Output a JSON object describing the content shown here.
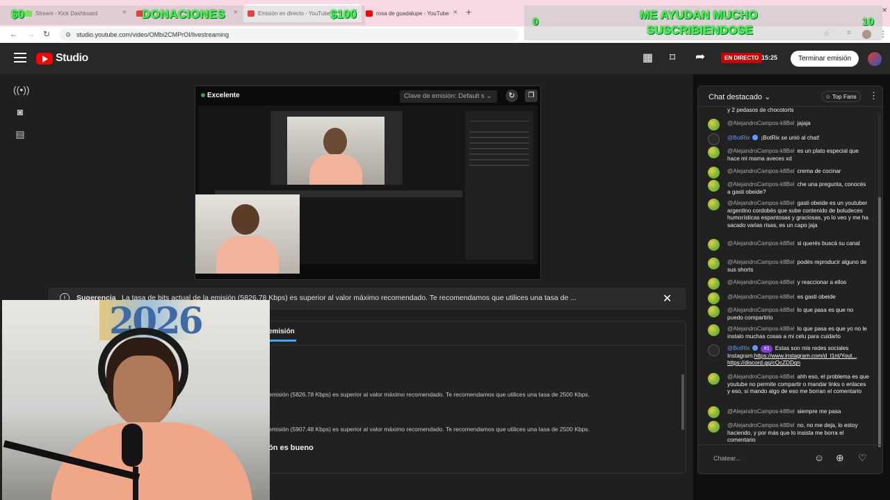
{
  "browser": {
    "tabs": [
      {
        "label": "Stream - Kick Dashboard",
        "favicon_color": "#53fc18"
      },
      {
        "label": "YouTube",
        "favicon_color": "#ff0000"
      },
      {
        "label": "Emisión en directo - YouTube",
        "favicon_color": "#ff0000"
      },
      {
        "label": "rosa de guadalupe - YouTube",
        "favicon_color": "#ff0000"
      }
    ],
    "url": "studio.youtube.com/video/OMbi2CMPrOI/livestreaming"
  },
  "overlay": {
    "left": {
      "amount_start": "$0",
      "title": "DONACIONES",
      "amount_goal": "$100"
    },
    "right": {
      "line1": "ME AYUDAN MUCHO",
      "line2": "SUSCRIBIENDOSE",
      "count_start": "0",
      "count_goal": "10"
    }
  },
  "studio": {
    "brand": "Studio",
    "live_label": "EN DIRECTO",
    "live_time": "15:25",
    "end_button": "Terminar emisión"
  },
  "preview": {
    "quality": "Excelente",
    "stream_key": "Clave de emisión: Default s"
  },
  "suggestion": {
    "title": "Sugerencia",
    "text": "La tasa de bits actual de la emisión (5826.78 Kbps) es superior al valor máximo recomendado. Te recomendamos que utilices una tasa de ..."
  },
  "panel": {
    "tab": "emisión",
    "rows": [
      "emisión (5826.78 Kbps) es superior al valor máximo recomendado. Te recomendamos que utilices una tasa de 2500 Kbps.",
      "emisión (5907.48 Kbps) es superior al valor máximo recomendado. Te recomendamos que utilices una tasa de 2500 Kbps.",
      "ón es bueno"
    ]
  },
  "webcam": {
    "sign": "2026"
  },
  "chat": {
    "title": "Chat destacado",
    "top_fans": "Top Fans",
    "input_placeholder": "Chatear...",
    "top_fragment": "y 2 pedasos de chocotorts",
    "messages": [
      {
        "author": "@AlejandroCampos-k8Bel",
        "text": "jajaja"
      },
      {
        "author": "@BotRix",
        "text": "¡BotRix se unió al chat!"
      },
      {
        "author": "@AlejandroCampos-k8Bel",
        "text": "es un plato especial que hace mi mama aveces xd"
      },
      {
        "author": "@AlejandroCampos-k8Bel",
        "text": "crema de cocinar"
      },
      {
        "author": "@AlejandroCampos-k8Bel",
        "text": "che una pregunta, conocés a gasti obeide?"
      },
      {
        "author": "@AlejandroCampos-k8Bel",
        "text": "gasti obeide es un youtuber argentino cordobés que sube contenido de boludeces humorísticas espantosas y graciosas, yo lo veo y me ha sacado varias risas, es un capo jaja"
      },
      {
        "author": "@AlejandroCampos-k8Bel",
        "text": "si querés buscá su canal"
      },
      {
        "author": "@AlejandroCampos-k8Bel",
        "text": "podés reproducir alguno de sus shorts"
      },
      {
        "author": "@AlejandroCampos-k8Bel",
        "text": "y reaccionar a ellos"
      },
      {
        "author": "@AlejandroCampos-k8Bel",
        "text": "es gasti obeide"
      },
      {
        "author": "@AlejandroCampos-k8Bel",
        "text": "lo que pasa es que no puedo compartirlo"
      },
      {
        "author": "@AlejandroCampos-k8Bel",
        "text": "lo que pasa es que yo no le instalo muchas cosas a mi celu para cuidarlo"
      },
      {
        "author": "@BotRix",
        "rank": "#1",
        "text": "Estas son mis redes sociales Instagram:",
        "link1": "https://www.instagram.com/d_l1nt/Yout...",
        "link2": "https://discord.gg/cQcZDDgn"
      },
      {
        "author": "@AlejandroCampos-k8Bel",
        "text": "ahh eso, el problema es que youtube no permite compartir o mandar links o enlaces y eso, si mando algo de eso me borran el comentario"
      },
      {
        "author": "@AlejandroCampos-k8Bel",
        "text": "siempre me pasa"
      },
      {
        "author": "@AlejandroCampos-k8Bel",
        "text": "no, no me deja, lo estoy haciendo, y por más que lo insista me borra el comentario"
      }
    ]
  }
}
